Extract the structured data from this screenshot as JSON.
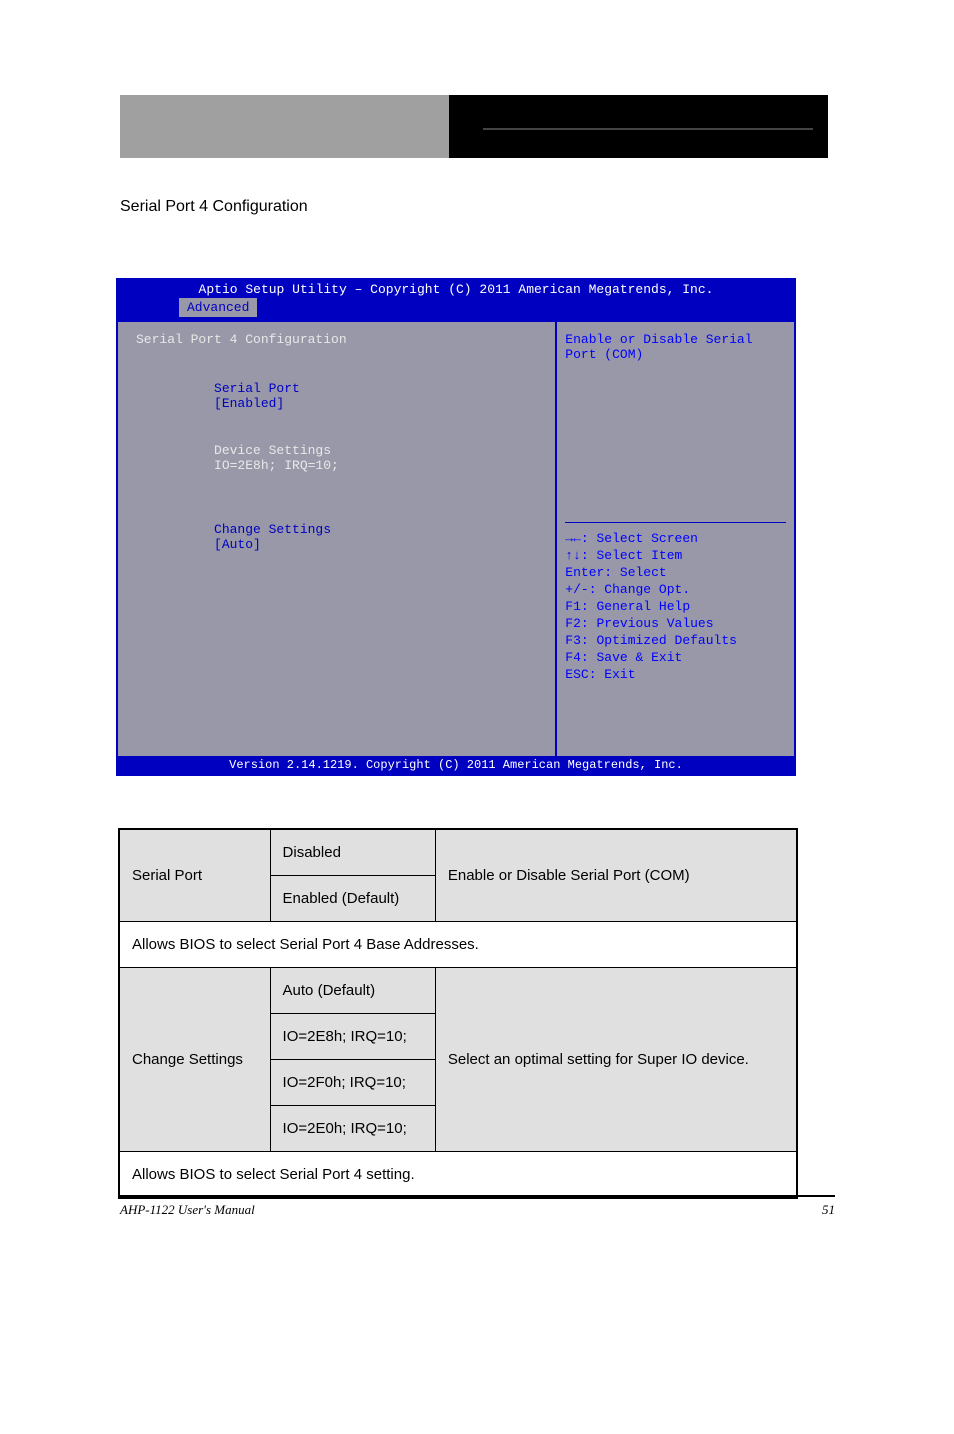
{
  "header": {
    "section_title": "Serial Port 4 Configuration"
  },
  "bios": {
    "title": "Aptio Setup Utility – Copyright (C) 2011 American Megatrends, Inc.",
    "tab": "Advanced",
    "main": {
      "heading": "Serial Port 4 Configuration",
      "items": [
        {
          "label": "Serial Port",
          "value": "[Enabled]",
          "blue": true
        },
        {
          "label": "Device Settings",
          "value": "IO=2E8h; IRQ=10;",
          "blue": false
        },
        {
          "spacer": true
        },
        {
          "label": "Change Settings",
          "value": "[Auto]",
          "blue": true
        }
      ]
    },
    "side": {
      "help_text": "Enable or Disable Serial Port (COM)",
      "keys": [
        "→←: Select Screen",
        "↑↓: Select Item",
        "Enter: Select",
        "+/-: Change Opt.",
        "F1: General Help",
        "F2: Previous Values",
        "F3: Optimized Defaults",
        "F4: Save & Exit",
        "ESC: Exit"
      ]
    },
    "footer": "Version 2.14.1219. Copyright (C) 2011 American Megatrends, Inc."
  },
  "table": {
    "rows": [
      {
        "c1": "Serial Port",
        "c2": [
          "Disabled",
          "Enabled (Default)"
        ],
        "c3": "Enable or Disable Serial Port (COM)",
        "grey": true
      },
      {
        "full": "Allows BIOS to select Serial Port 4 Base Addresses.",
        "grey": false
      },
      {
        "c1": "Change Settings",
        "c2": [
          "Auto (Default)",
          "IO=2E8h; IRQ=10;",
          "IO=2F0h; IRQ=10;",
          "IO=2E0h; IRQ=10;"
        ],
        "c3": "Select an optimal setting for Super IO device.",
        "grey": true
      },
      {
        "full": "Allows BIOS to select Serial Port 4 setting.",
        "grey": false
      }
    ]
  },
  "footer": {
    "left": "AHP-1122 User's Manual",
    "right": "51"
  }
}
